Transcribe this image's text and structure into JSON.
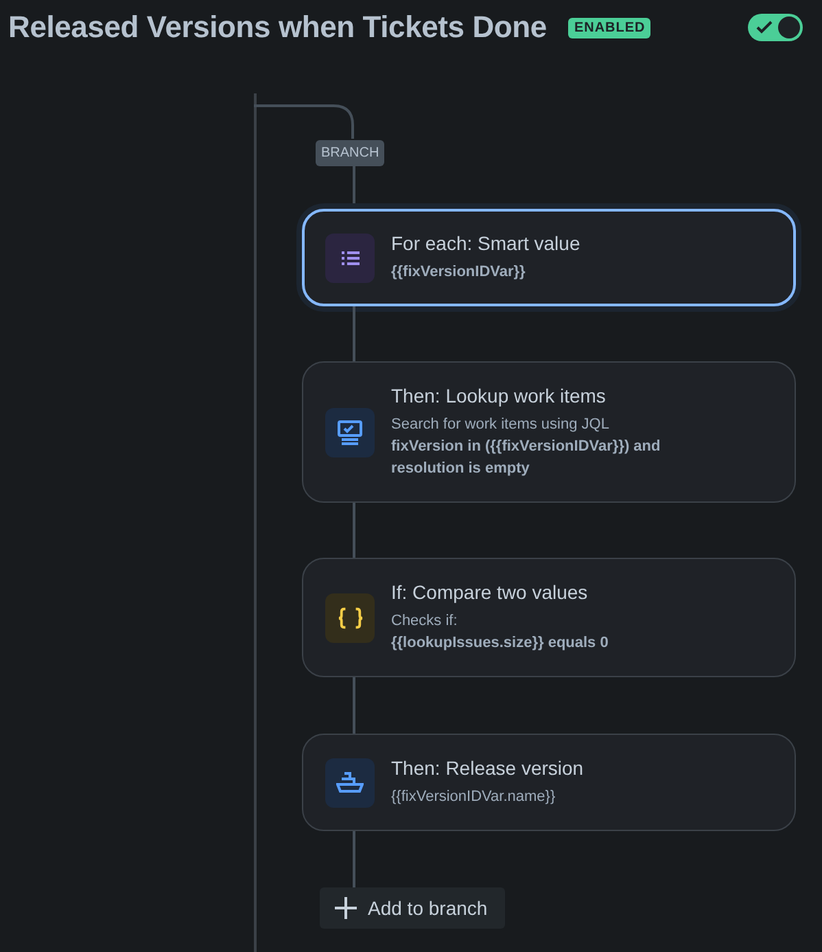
{
  "header": {
    "title": "Released Versions when Tickets Done",
    "status": "ENABLED",
    "toggle": {
      "on": true
    }
  },
  "branch": {
    "label": "BRANCH",
    "steps": [
      {
        "kind": "foreach",
        "selected": true,
        "title": "For each: Smart value",
        "lines": [
          {
            "text": "{{fixVersionIDVar}}",
            "bold": true
          }
        ]
      },
      {
        "kind": "lookup",
        "selected": false,
        "title": "Then: Lookup work items",
        "lines": [
          {
            "text": "Search for work items using JQL",
            "bold": false
          },
          {
            "text": "fixVersion in ({{fixVersionIDVar}}) and resolution is empty",
            "bold": true
          }
        ]
      },
      {
        "kind": "condition",
        "selected": false,
        "title": "If: Compare two values",
        "lines": [
          {
            "text": "Checks if:",
            "bold": false
          },
          {
            "text": "{{lookupIssues.size}} equals 0",
            "bold": true
          }
        ]
      },
      {
        "kind": "action",
        "selected": false,
        "title": "Then: Release version",
        "lines": [
          {
            "text": "{{fixVersionIDVar.name}}",
            "bold": false
          }
        ]
      }
    ],
    "add_button": "Add to branch"
  }
}
